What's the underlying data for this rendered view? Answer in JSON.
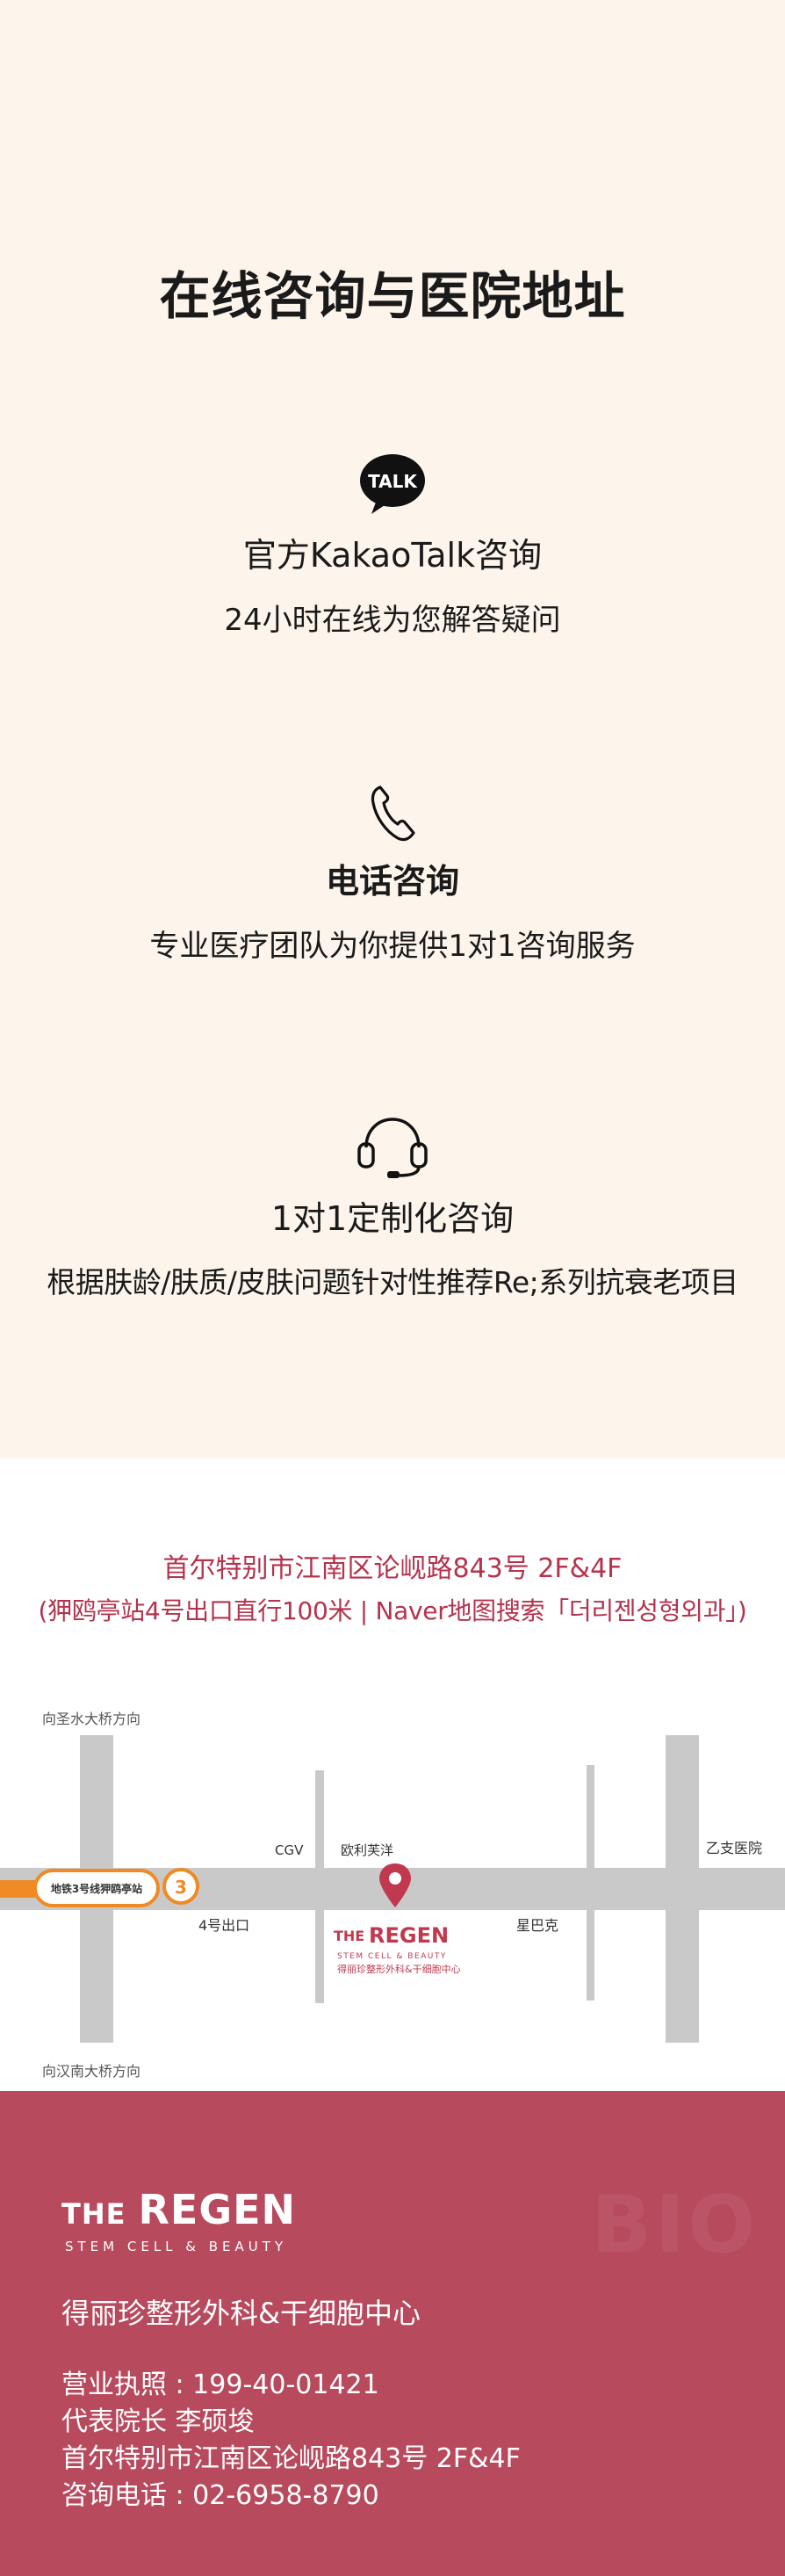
{
  "consult": {
    "title": "在线咨询与医院地址",
    "kakao": {
      "icon": "kakaotalk-icon",
      "icon_text": "TALK",
      "title": "官方KakaoTalk咨询",
      "subtitle": "24小时在线为您解答疑问"
    },
    "phone": {
      "icon": "phone-icon",
      "title": "电话咨询",
      "subtitle": "专业医疗团队为你提供1对1咨询服务"
    },
    "custom": {
      "icon": "headset-icon",
      "title": "1对1定制化咨询",
      "subtitle": "根据肤龄/肤质/皮肤问题针对性推荐Re;系列抗衰老项目"
    }
  },
  "address": {
    "line1": "首尔特别市江南区论岘路843号 2F&4F",
    "line2": "(狎鸥亭站4号出口直行100米 | Naver地图搜索「더리젠성형외과」)"
  },
  "map": {
    "north_label": "向圣水大桥方向",
    "south_label": "向汉南大桥方向",
    "subway_station": "地铁3号线狎鸥亭站",
    "line_number": "3",
    "exit_label": "4号出口",
    "cgv": "CGV",
    "olive": "欧利芙洋",
    "starbucks": "星巴克",
    "hospital": "乙支医院",
    "brand_the": "THE",
    "brand_name": "REGEN",
    "brand_sub": "STEM CELL & BEAUTY",
    "brand_cn": "得丽珍整形外科&干细胞中心",
    "line_color": "#f08a24",
    "pin_color": "#c0394f"
  },
  "footer": {
    "logo_the": "THE",
    "logo_name": "REGEN",
    "logo_sub": "STEM CELL & BEAUTY",
    "name": "得丽珍整形外科&干细胞中心",
    "license": "营业执照 : 199-40-01421",
    "director": "代表院长 李硕埈",
    "address": "首尔特别市江南区论岘路843号 2F&4F",
    "phone": "咨询电话 : 02-6958-8790",
    "bg_color": "#b84a5e"
  }
}
